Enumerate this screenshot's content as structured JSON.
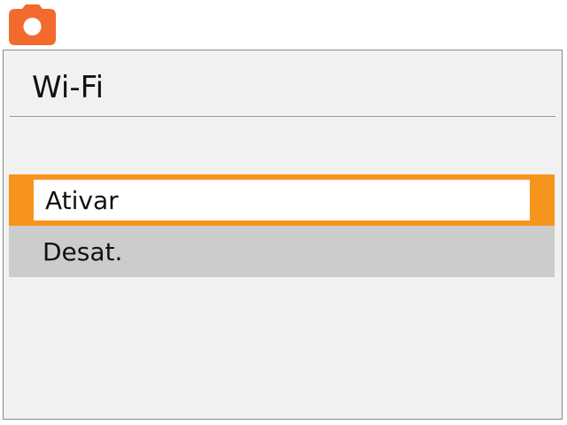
{
  "tab": {
    "icon": "camera-icon",
    "color": "#f26b2d"
  },
  "screen": {
    "title": "Wi-Fi"
  },
  "options": [
    {
      "label": "Ativar",
      "selected": true
    },
    {
      "label": "Desat.",
      "selected": false
    }
  ],
  "colors": {
    "highlight": "#f7941e",
    "unselected_row": "#cccccc",
    "panel_bg": "#f1f1f1"
  }
}
